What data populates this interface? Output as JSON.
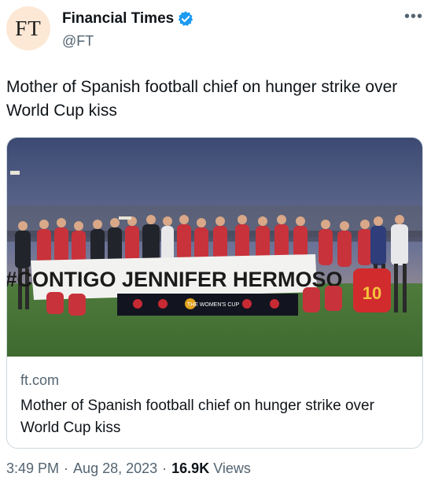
{
  "author": {
    "avatar_text": "FT",
    "display_name": "Financial Times",
    "handle": "@FT"
  },
  "more_label": "•••",
  "tweet": {
    "text": "Mother of Spanish football chief on hunger strike over World Cup kiss"
  },
  "card": {
    "image": {
      "banner_text": "#CONTIGO JENNIFER HERMOSO",
      "sponsor_text": "THE WOMEN'S CUP",
      "jersey_number": "10"
    },
    "domain": "ft.com",
    "title": "Mother of Spanish football chief on hunger strike over World Cup kiss"
  },
  "footer": {
    "time": "3:49 PM",
    "separator": "·",
    "date": "Aug 28, 2023",
    "views_count": "16.9K",
    "views_label": "Views"
  },
  "colors": {
    "verified_badge": "#1d9bf0",
    "text_primary": "#0f1419",
    "text_secondary": "#536471",
    "border": "#cfd9de",
    "avatar_bg": "#fce8d5"
  }
}
